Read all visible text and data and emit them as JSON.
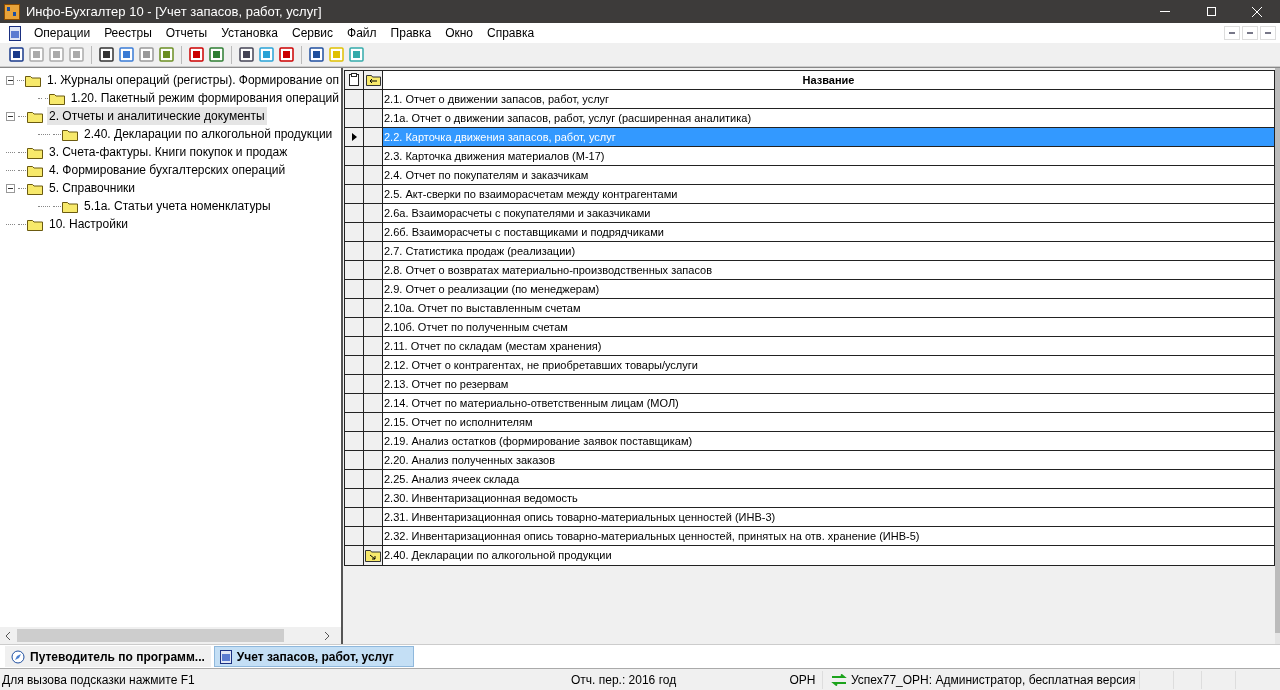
{
  "window": {
    "title": "Инфо-Бухгалтер 10 - [Учет запасов, работ, услуг]"
  },
  "menu": [
    "Операции",
    "Реестры",
    "Отчеты",
    "Установка",
    "Сервис",
    "Файл",
    "Правка",
    "Окно",
    "Справка"
  ],
  "tree": [
    {
      "label": "1. Журналы операций (регистры). Формирование оп",
      "expanded": true,
      "selected": false,
      "children": [
        {
          "label": "1.20. Пакетный режим формирования операций",
          "selected": false
        }
      ]
    },
    {
      "label": "2. Отчеты и аналитические документы",
      "expanded": true,
      "selected": true,
      "children": [
        {
          "label": "2.40. Декларации по алкогольной продукции",
          "selected": false
        }
      ]
    },
    {
      "label": "3. Счета-фактуры. Книги покупок и продаж",
      "expanded": false,
      "selected": false
    },
    {
      "label": "4. Формирование бухгалтерских операций",
      "expanded": false,
      "selected": false
    },
    {
      "label": "5. Справочники",
      "expanded": true,
      "selected": false,
      "children": [
        {
          "label": "5.1а. Статьи учета номенклатуры",
          "selected": false
        }
      ]
    },
    {
      "label": "10. Настройки",
      "expanded": false,
      "selected": false
    }
  ],
  "table": {
    "columns": [
      "Название"
    ],
    "rows": [
      {
        "name": "2.1. Отчет о движении запасов, работ, услуг",
        "kind": "report",
        "selected": false
      },
      {
        "name": "2.1а. Отчет о движении запасов, работ, услуг (расширенная аналитика)",
        "kind": "report",
        "selected": false
      },
      {
        "name": "2.2. Карточка движения запасов, работ, услуг",
        "kind": "report",
        "selected": true
      },
      {
        "name": "2.3. Карточка движения материалов (М-17)",
        "kind": "report",
        "selected": false
      },
      {
        "name": "2.4. Отчет по покупателям и заказчикам",
        "kind": "report",
        "selected": false
      },
      {
        "name": "2.5. Акт-сверки по взаиморасчетам между контрагентами",
        "kind": "report",
        "selected": false
      },
      {
        "name": "2.6а. Взаиморасчеты с покупателями и заказчиками",
        "kind": "report",
        "selected": false
      },
      {
        "name": "2.6б. Взаиморасчеты с поставщиками и подрядчиками",
        "kind": "report",
        "selected": false
      },
      {
        "name": "2.7. Статистика продаж (реализации)",
        "kind": "report",
        "selected": false
      },
      {
        "name": "2.8. Отчет о возвратах материально-производственных запасов",
        "kind": "report",
        "selected": false
      },
      {
        "name": "2.9. Отчет о реализации (по менеджерам)",
        "kind": "report",
        "selected": false
      },
      {
        "name": "2.10а. Отчет по выставленным счетам",
        "kind": "report",
        "selected": false
      },
      {
        "name": "2.10б. Отчет по полученным счетам",
        "kind": "report",
        "selected": false
      },
      {
        "name": "2.11. Отчет по складам (местам хранения)",
        "kind": "report",
        "selected": false
      },
      {
        "name": "2.12. Отчет о контрагентах, не приобретавших товары/услуги",
        "kind": "report",
        "selected": false
      },
      {
        "name": "2.13. Отчет по резервам",
        "kind": "report",
        "selected": false
      },
      {
        "name": "2.14. Отчет по материально-ответственным лицам (МОЛ)",
        "kind": "report",
        "selected": false
      },
      {
        "name": "2.15. Отчет по исполнителям",
        "kind": "report",
        "selected": false
      },
      {
        "name": "2.19. Анализ остатков (формирование заявок поставщикам)",
        "kind": "report",
        "selected": false
      },
      {
        "name": "2.20. Анализ полученных заказов",
        "kind": "report",
        "selected": false
      },
      {
        "name": "2.25. Анализ ячеек склада",
        "kind": "report",
        "selected": false
      },
      {
        "name": "2.30. Инвентаризационная ведомость",
        "kind": "report",
        "selected": false
      },
      {
        "name": "2.31. Инвентаризационная опись товарно-материальных ценностей (ИНВ-3)",
        "kind": "report",
        "selected": false
      },
      {
        "name": "2.32. Инвентаризационная опись товарно-материальных ценностей, принятых на отв. хранение (ИНВ-5)",
        "kind": "report",
        "selected": false
      },
      {
        "name": "2.40. Декларации по алкогольной продукции",
        "kind": "folder",
        "selected": false
      }
    ]
  },
  "tabs": [
    {
      "label": "Путеводитель по программ...",
      "selected": false
    },
    {
      "label": "Учет запасов, работ, услуг",
      "selected": true
    }
  ],
  "status_bar": {
    "hint": "Для вызова подсказки нажмите F1",
    "period": "Отч. пер.: 2016 год",
    "org": "ОРН",
    "user": "Успех77_ОРН: Администратор, бесплатная версия"
  }
}
